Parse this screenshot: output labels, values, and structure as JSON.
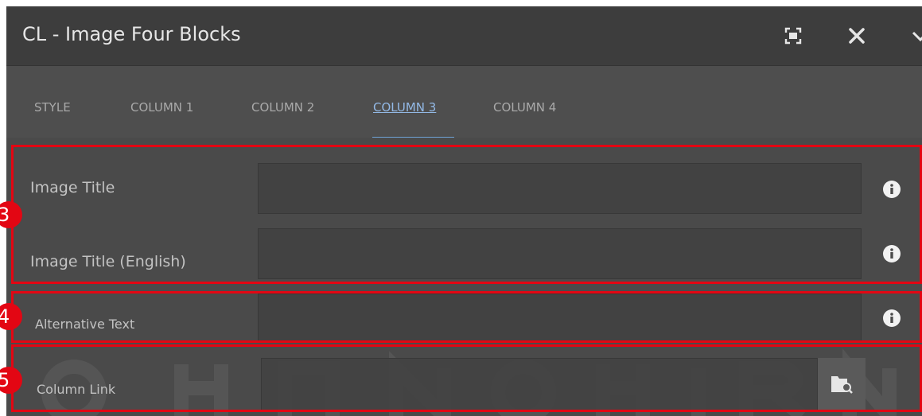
{
  "dialog": {
    "title": "CL - Image Four Blocks",
    "icons": {
      "fullscreen": "fullscreen-icon",
      "close": "close-icon",
      "more": "chevron-down-icon"
    }
  },
  "tabs": [
    {
      "label": "STYLE",
      "active": false
    },
    {
      "label": "COLUMN 1",
      "active": false
    },
    {
      "label": "COLUMN 2",
      "active": false
    },
    {
      "label": "COLUMN 3",
      "active": true
    },
    {
      "label": "COLUMN 4",
      "active": false
    }
  ],
  "fields": {
    "image_title": {
      "label": "Image Title",
      "value": ""
    },
    "image_title_english": {
      "label": "Image Title (English)",
      "value": ""
    },
    "alternative_text": {
      "label": "Alternative Text",
      "value": ""
    },
    "column_link": {
      "label": "Column Link",
      "value": ""
    }
  },
  "annotations": [
    {
      "number": "3"
    },
    {
      "number": "4"
    },
    {
      "number": "5"
    }
  ],
  "colors": {
    "annotation": "#e30613",
    "tab_active": "#93b9e6",
    "tab_indicator": "#6fa3d6"
  }
}
